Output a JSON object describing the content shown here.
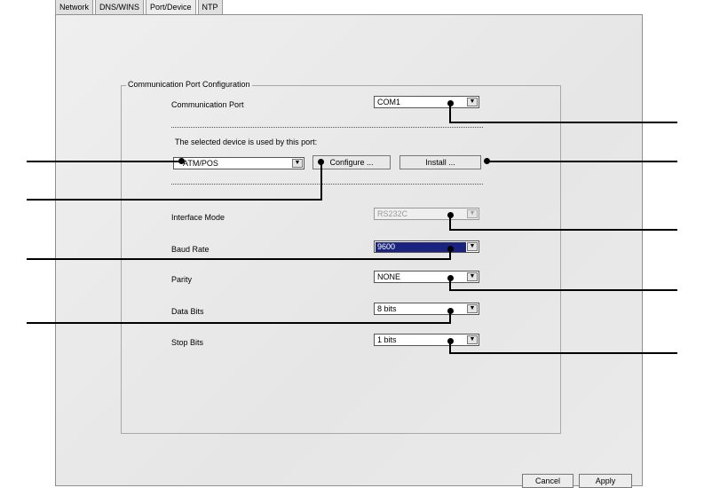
{
  "tabs": [
    "Network",
    "DNS/WINS",
    "Port/Device",
    "NTP"
  ],
  "group_title": "Communication Port Configuration",
  "communication_port": {
    "label": "Communication Port",
    "value": "COM1"
  },
  "device_note": "The selected device is used by this port:",
  "device_select": {
    "value": "ATM/POS"
  },
  "buttons": {
    "configure": "Configure ...",
    "install": "Install ..."
  },
  "interface_mode": {
    "label": "Interface Mode",
    "value": "RS232C"
  },
  "baud_rate": {
    "label": "Baud Rate",
    "value": "9600"
  },
  "parity": {
    "label": "Parity",
    "value": "NONE"
  },
  "data_bits": {
    "label": "Data Bits",
    "value": "8 bits"
  },
  "stop_bits": {
    "label": "Stop Bits",
    "value": "1 bits"
  },
  "footer": {
    "cancel": "Cancel",
    "apply": "Apply"
  },
  "icons": {
    "dropdown": "▼"
  }
}
